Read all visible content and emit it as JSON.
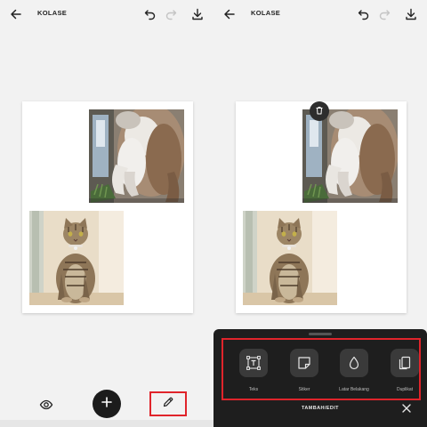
{
  "app": {
    "title": "KOLASE"
  },
  "colors": {
    "highlight": "#e0242b",
    "sheet_bg": "#1e1e1e",
    "fab_bg": "#1c1c1c",
    "tile_bg": "#3a3a3a"
  },
  "icons": {
    "back": "arrow-left-icon",
    "undo": "undo-icon",
    "redo": "redo-icon",
    "download": "download-icon",
    "preview": "eye-icon",
    "add": "plus-icon",
    "edit": "pencil-icon",
    "delete": "trash-icon",
    "close": "close-icon"
  },
  "collage": {
    "photos": [
      {
        "subject": "cat-standing-closeup"
      },
      {
        "subject": "tabby-cat-sitting"
      }
    ]
  },
  "edit_sheet": {
    "title": "TAMBAH/EDIT",
    "tools": [
      {
        "label": "Teks",
        "icon": "text-frame-icon"
      },
      {
        "label": "Stiker",
        "icon": "sticker-icon"
      },
      {
        "label": "Latar Belakang",
        "icon": "droplet-icon"
      },
      {
        "label": "Duplikat",
        "icon": "duplicate-icon"
      }
    ]
  }
}
